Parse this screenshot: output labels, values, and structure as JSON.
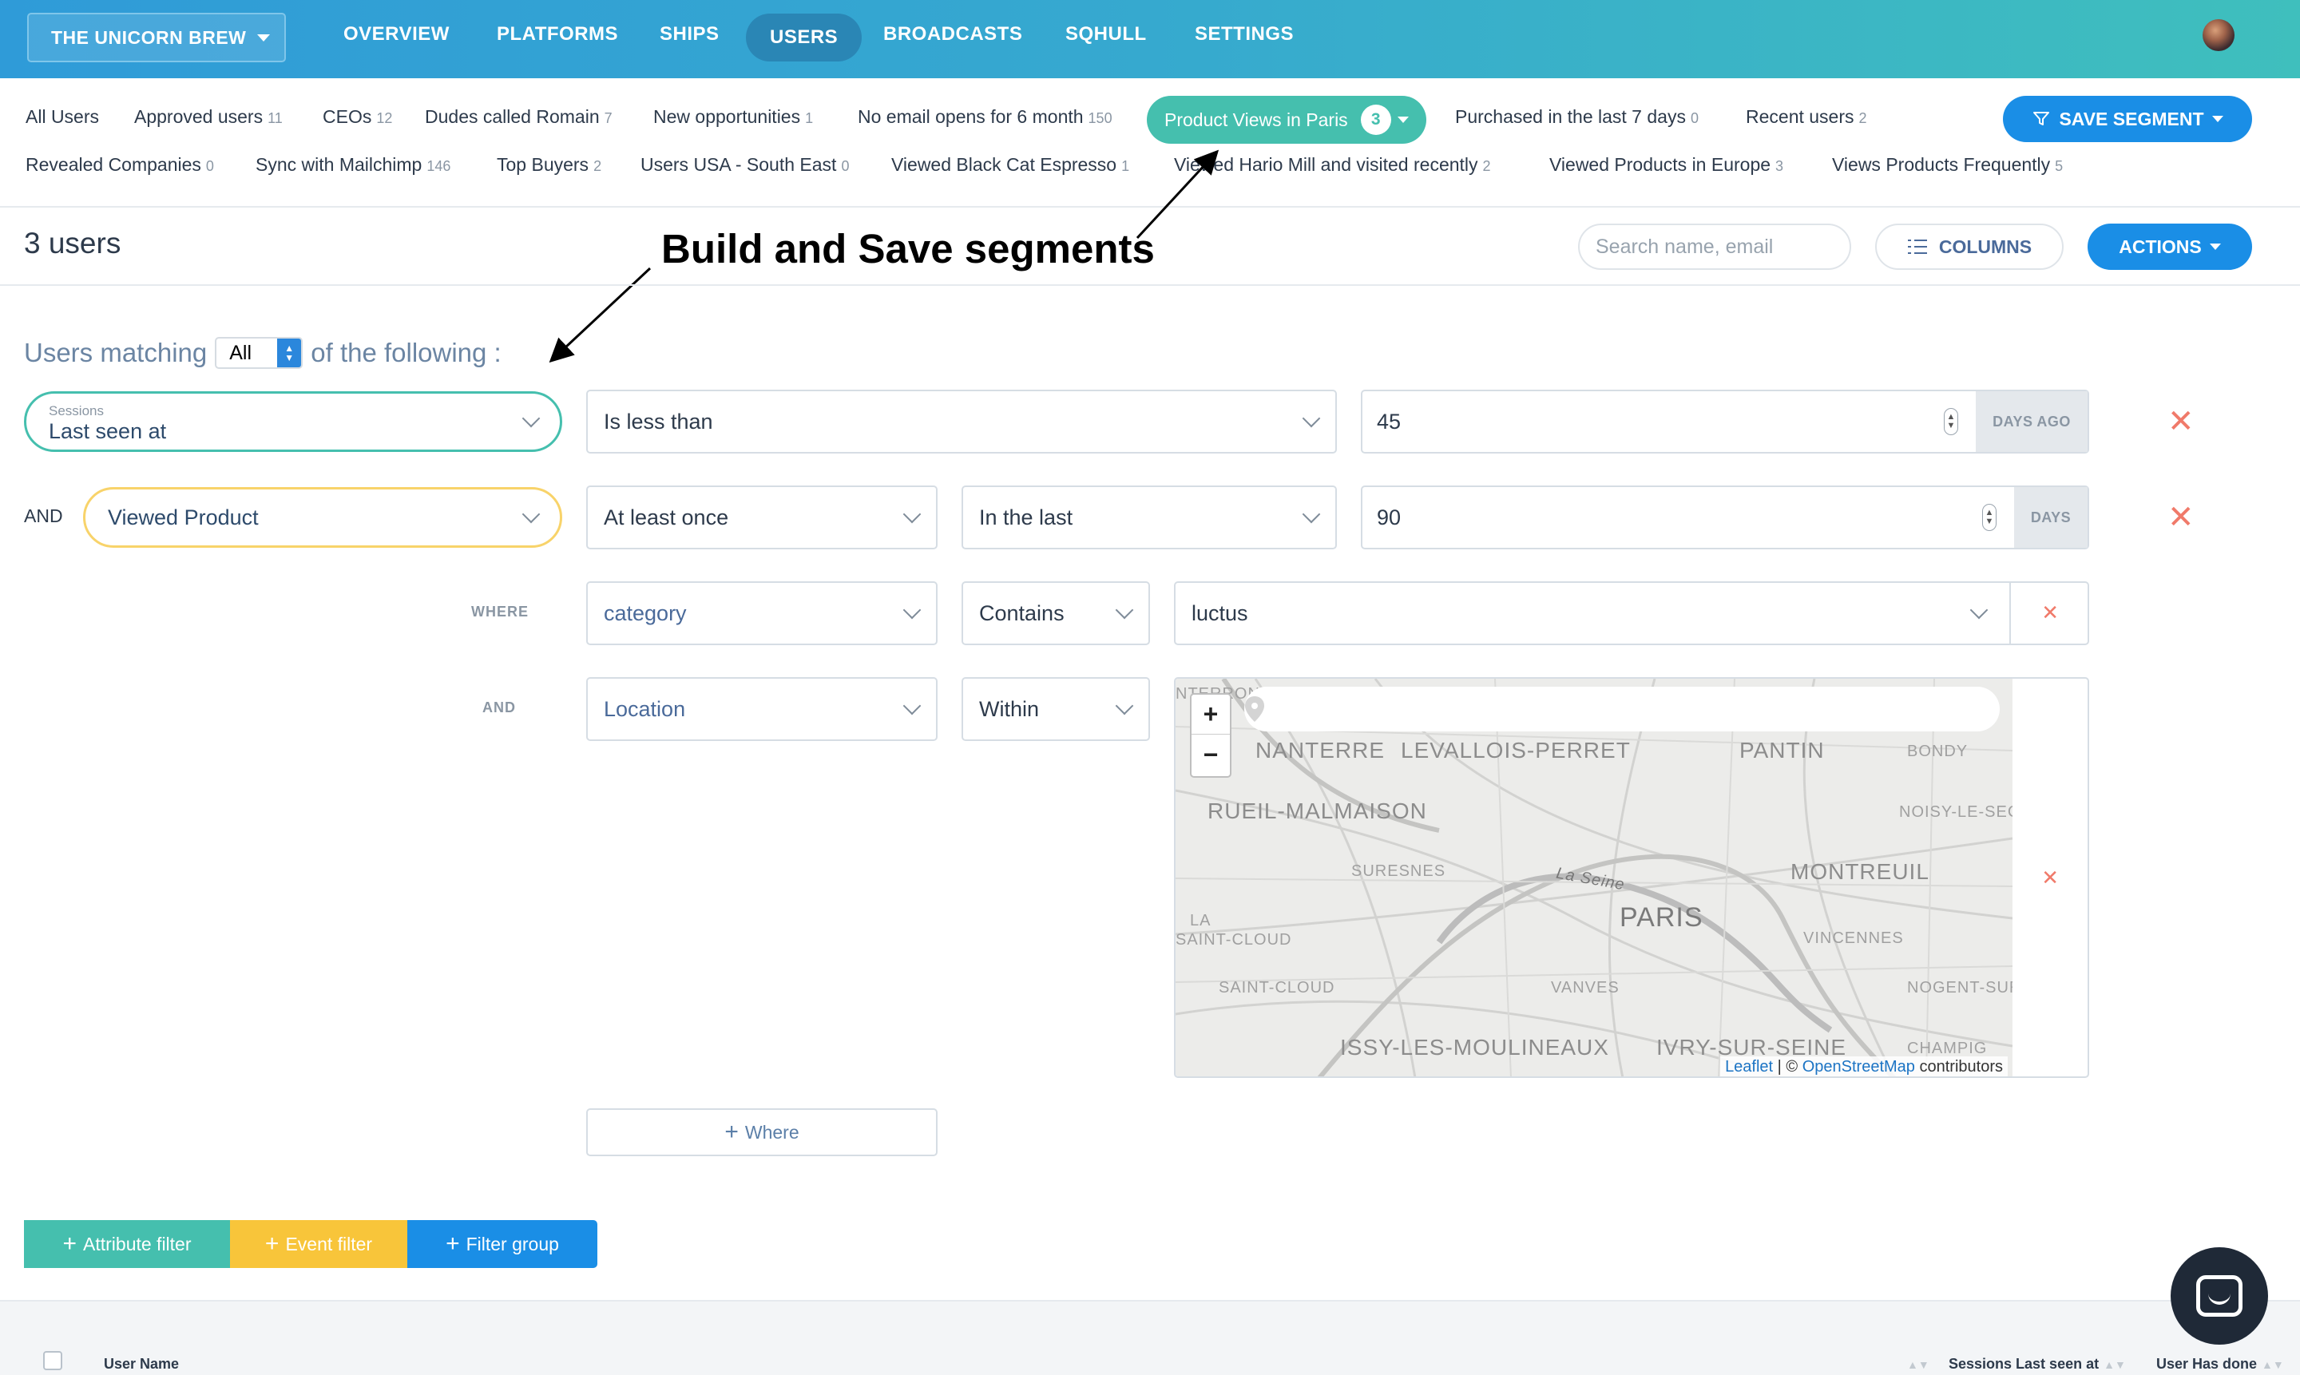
{
  "nav": {
    "brand": "THE UNICORN BREW",
    "items": [
      "OVERVIEW",
      "PLATFORMS",
      "SHIPS",
      "USERS",
      "BROADCASTS",
      "SQHULL",
      "SETTINGS"
    ],
    "active": "USERS"
  },
  "segments": {
    "row1": [
      {
        "label": "All Users",
        "count": ""
      },
      {
        "label": "Approved users",
        "count": "11"
      },
      {
        "label": "CEOs",
        "count": "12"
      },
      {
        "label": "Dudes called Romain",
        "count": "7"
      },
      {
        "label": "New opportunities",
        "count": "1"
      },
      {
        "label": "No email opens for 6 month",
        "count": "150"
      }
    ],
    "active": {
      "label": "Product Views in Paris",
      "count": "3"
    },
    "row1b": [
      {
        "label": "Purchased in the last 7 days",
        "count": "0"
      },
      {
        "label": "Recent users",
        "count": "2"
      }
    ],
    "row2": [
      {
        "label": "Revealed Companies",
        "count": "0"
      },
      {
        "label": "Sync with Mailchimp",
        "count": "146"
      },
      {
        "label": "Top Buyers",
        "count": "2"
      },
      {
        "label": "Users USA - South East",
        "count": "0"
      },
      {
        "label": "Viewed Black Cat Espresso",
        "count": "1"
      },
      {
        "label": "Viewed Hario Mill and visited recently",
        "count": "2"
      },
      {
        "label": "Viewed Products in Europe",
        "count": "3"
      },
      {
        "label": "Views Products Frequently",
        "count": "5"
      }
    ],
    "save_label": "SAVE SEGMENT"
  },
  "header": {
    "user_count": "3 users",
    "annotation": "Build and Save segments",
    "search_placeholder": "Search name, email",
    "columns_label": "COLUMNS",
    "actions_label": "ACTIONS"
  },
  "filters": {
    "matching_prefix": "Users matching",
    "matching_value": "All",
    "matching_suffix": "of the following :",
    "row1": {
      "attr_group": "Sessions",
      "attr": "Last seen at",
      "operator": "Is less than",
      "value": "45",
      "unit": "DAYS AGO"
    },
    "row2": {
      "conj": "AND",
      "event": "Viewed Product",
      "frequency": "At least once",
      "timeframe": "In the last",
      "value": "90",
      "unit": "DAYS"
    },
    "where1": {
      "label": "WHERE",
      "property": "category",
      "operator": "Contains",
      "value": "luctus"
    },
    "where2": {
      "label": "AND",
      "property": "Location",
      "operator": "Within"
    },
    "map": {
      "labels": [
        "NANTERRE",
        "LEVALLOIS-PERRET",
        "PANTIN",
        "BONDY",
        "RUEIL-MALMAISON",
        "NOISY-LE-SEC",
        "SURESNES",
        "La Seine",
        "PARIS",
        "MONTREUIL",
        "LA",
        "SAINT-CLOUD",
        "VINCENNES",
        "SAINT-CLOUD",
        "VANVES",
        "NOGENT-SUR-",
        "ISSY-LES-MOULINEAUX",
        "IVRY-SUR-SEINE",
        "CHAMPIG",
        "NTERRON"
      ],
      "zoom_in": "+",
      "zoom_out": "−",
      "attribution_leaflet": "Leaflet",
      "attribution_sep": " | © ",
      "attribution_osm": "OpenStreetMap",
      "attribution_suffix": " contributors"
    },
    "add_where": "Where",
    "buttons": {
      "attribute": "Attribute filter",
      "event": "Event filter",
      "group": "Filter group"
    }
  },
  "table": {
    "headers": [
      "User Name",
      "Sessions Last seen at",
      "User Has done"
    ]
  },
  "colors": {
    "nav_start": "#2f9bd8",
    "nav_end": "#3fbfbd",
    "teal": "#45bfae",
    "blue": "#1a8ee6",
    "yellow": "#f8c53a",
    "red_x": "#f07a6a"
  }
}
